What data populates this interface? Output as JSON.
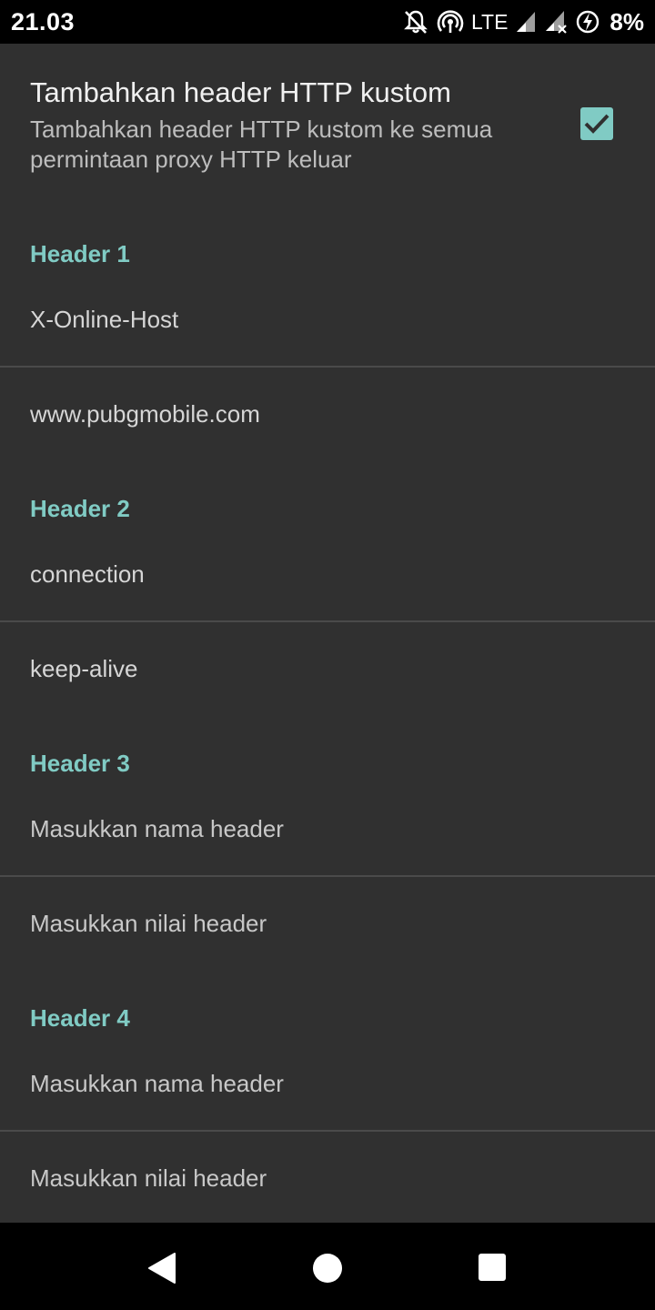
{
  "status_bar": {
    "time": "21.03",
    "network": "LTE",
    "battery": "8%",
    "icons": [
      "notifications-off-icon",
      "hotspot-icon",
      "signal-icon",
      "signal-no-data-icon",
      "battery-charging-icon"
    ]
  },
  "custom_headers": {
    "title": "Tambahkan header HTTP kustom",
    "summary": "Tambahkan header HTTP kustom ke semua permintaan proxy HTTP keluar",
    "enabled": true
  },
  "headers": [
    {
      "label": "Header 1",
      "name": "X-Online-Host",
      "value": "www.pubgmobile.com"
    },
    {
      "label": "Header 2",
      "name": "connection",
      "value": "keep-alive"
    },
    {
      "label": "Header 3",
      "name": "Masukkan nama header",
      "value": "Masukkan nilai header"
    },
    {
      "label": "Header 4",
      "name": "Masukkan nama header",
      "value": "Masukkan nilai header"
    }
  ],
  "colors": {
    "accent": "#80cbc4",
    "background": "#303030",
    "bars": "#000000"
  },
  "nav": {
    "icons": [
      "back-icon",
      "home-icon",
      "recents-icon"
    ]
  }
}
